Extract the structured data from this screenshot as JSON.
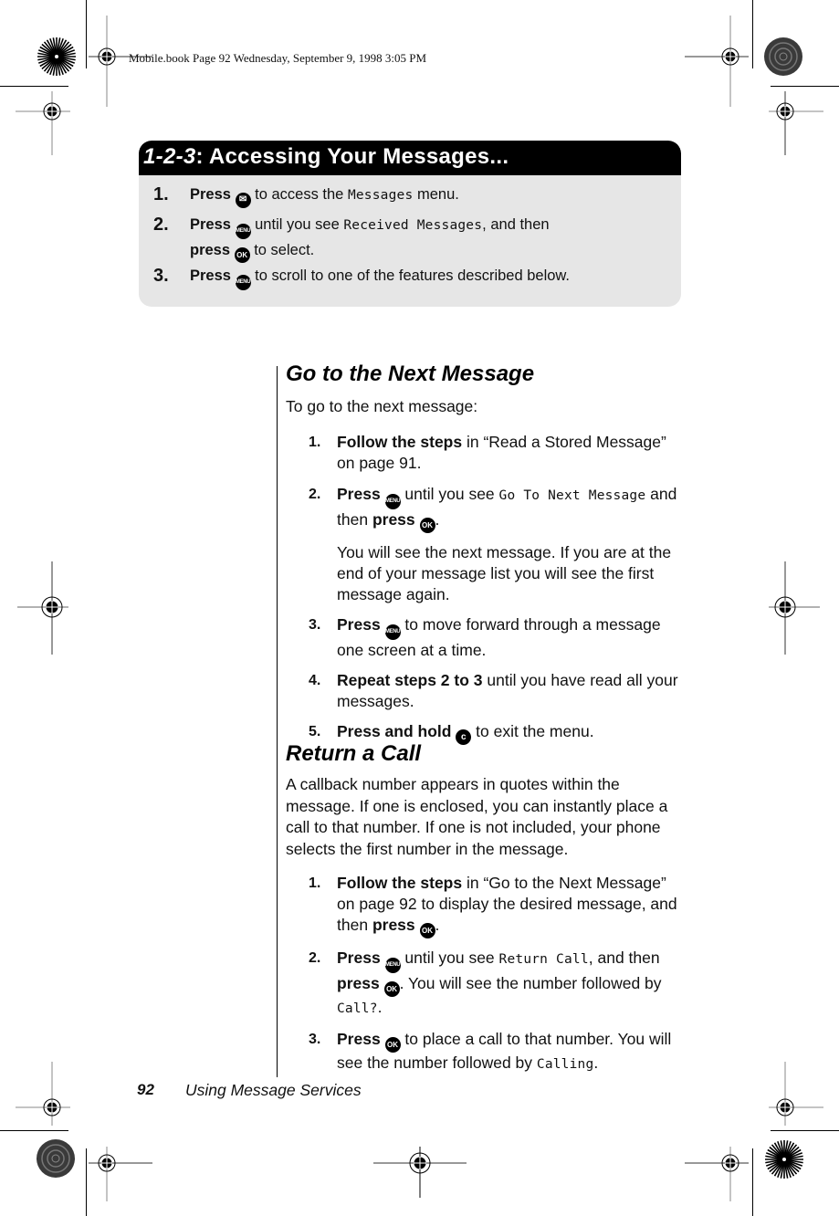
{
  "slug": "Mobile.book  Page 92  Wednesday, September 9, 1998  3:05 PM",
  "quick_box": {
    "title_prefix": "1-2-3",
    "title_rest": ":  Accessing Your Messages...",
    "steps": [
      {
        "num": "1.",
        "parts": [
          {
            "b": "Press "
          },
          {
            "icon": "envelope-icon"
          },
          {
            "t": " to access the "
          },
          {
            "lcd": "Messages"
          },
          {
            "t": " menu."
          }
        ]
      },
      {
        "num": "2.",
        "parts": [
          {
            "b": "Press "
          },
          {
            "icon": "menu-icon"
          },
          {
            "t": "  until you see "
          },
          {
            "lcd": "Received Messages"
          },
          {
            "t": ", and then"
          },
          {
            "br": true
          },
          {
            "b": "press "
          },
          {
            "icon": "ok-icon"
          },
          {
            "t": "  to select."
          }
        ]
      },
      {
        "num": "3.",
        "parts": [
          {
            "b": "Press "
          },
          {
            "icon": "menu-icon"
          },
          {
            "t": "  to scroll to one of the features described below."
          }
        ]
      }
    ]
  },
  "sections": [
    {
      "heading": "Go to the Next Message",
      "intro": "To go to the next message:",
      "steps": [
        {
          "num": "1.",
          "parts": [
            {
              "b": "Follow the steps"
            },
            {
              "t": " in “Read a Stored Message” on page 91."
            }
          ]
        },
        {
          "num": "2.",
          "parts": [
            {
              "b": "Press "
            },
            {
              "icon": "menu-icon"
            },
            {
              "t": "  until you see "
            },
            {
              "lcd": "Go To Next Message"
            },
            {
              "t": " and then "
            },
            {
              "b": "press "
            },
            {
              "icon": "ok-icon"
            },
            {
              "t": "."
            }
          ],
          "sub": "You will see the next message. If you are at the end of your message list you will see the first message again."
        },
        {
          "num": "3.",
          "parts": [
            {
              "b": "Press "
            },
            {
              "icon": "menu-icon"
            },
            {
              "t": "  to move forward through a message one screen at a time."
            }
          ]
        },
        {
          "num": "4.",
          "parts": [
            {
              "b": "Repeat steps 2 to 3"
            },
            {
              "t": " until you have read all your messages."
            }
          ]
        },
        {
          "num": "5.",
          "parts": [
            {
              "b": "Press and hold "
            },
            {
              "icon": "clear-icon"
            },
            {
              "t": " to exit the menu."
            }
          ]
        }
      ]
    },
    {
      "heading": "Return a Call",
      "intro": "A callback number appears in quotes within the message. If one is enclosed, you can instantly place a call to that number. If one is not included, your phone selects the first number in the message.",
      "steps": [
        {
          "num": "1.",
          "parts": [
            {
              "b": "Follow the steps"
            },
            {
              "t": " in “Go to the Next Message” on page 92 to display the desired message, and then "
            },
            {
              "b": "press "
            },
            {
              "icon": "ok-icon"
            },
            {
              "t": "."
            }
          ]
        },
        {
          "num": "2.",
          "parts": [
            {
              "b": "Press "
            },
            {
              "icon": "menu-icon"
            },
            {
              "t": "  until you see "
            },
            {
              "lcd": "Return Call"
            },
            {
              "t": ", and then "
            },
            {
              "b": "press "
            },
            {
              "icon": "ok-icon"
            },
            {
              "t": ". You will see the number followed by  "
            },
            {
              "lcd": "Call?"
            },
            {
              "t": "."
            }
          ]
        },
        {
          "num": "3.",
          "parts": [
            {
              "b": "Press "
            },
            {
              "icon": "ok-icon"
            },
            {
              "t": " to place a call to that number. You will see the number followed by "
            },
            {
              "lcd": "Calling"
            },
            {
              "t": "."
            }
          ]
        }
      ]
    }
  ],
  "icons": {
    "envelope-icon": "✉",
    "menu-icon": "MENU",
    "ok-icon": "OK",
    "clear-icon": "c"
  },
  "footer": {
    "page_number": "92",
    "chapter": "Using Message Services"
  }
}
